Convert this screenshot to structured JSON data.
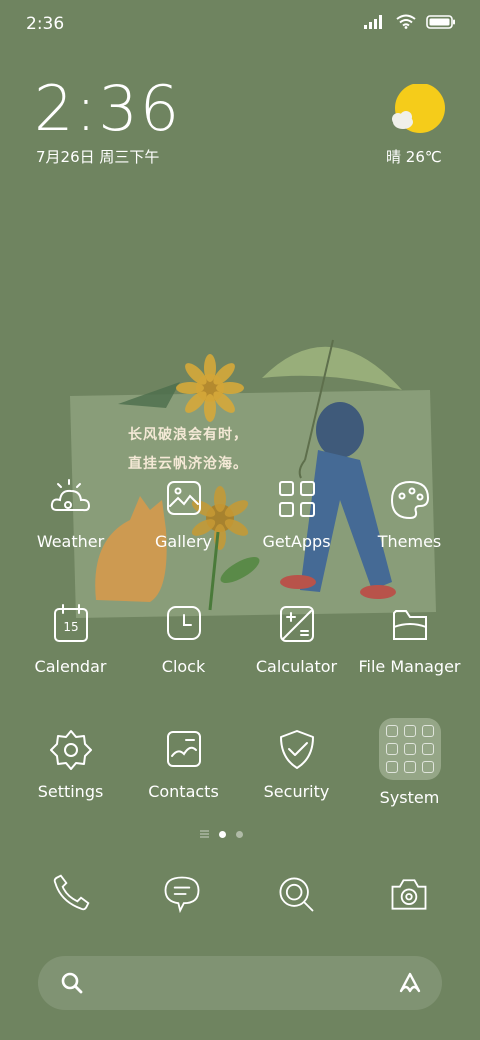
{
  "status_bar": {
    "time": "2:36"
  },
  "clock_widget": {
    "time": "2:36",
    "date": "7月26日 周三下午"
  },
  "weather_widget": {
    "condition": "晴",
    "temperature": "26℃"
  },
  "wallpaper": {
    "line1": "长风破浪会有时，",
    "line2": "直挂云帆济沧海。"
  },
  "apps": {
    "weather": "Weather",
    "gallery": "Gallery",
    "getapps": "GetApps",
    "themes": "Themes",
    "calendar": "Calendar",
    "calendar_day": "15",
    "clock": "Clock",
    "calculator": "Calculator",
    "file_manager": "File Manager",
    "settings": "Settings",
    "contacts": "Contacts",
    "security": "Security",
    "system": "System"
  },
  "dock": [
    "phone-icon",
    "messages-icon",
    "browser-icon",
    "camera-icon"
  ],
  "colors": {
    "background": "#6f8460",
    "sun": "#f5cc1a"
  }
}
